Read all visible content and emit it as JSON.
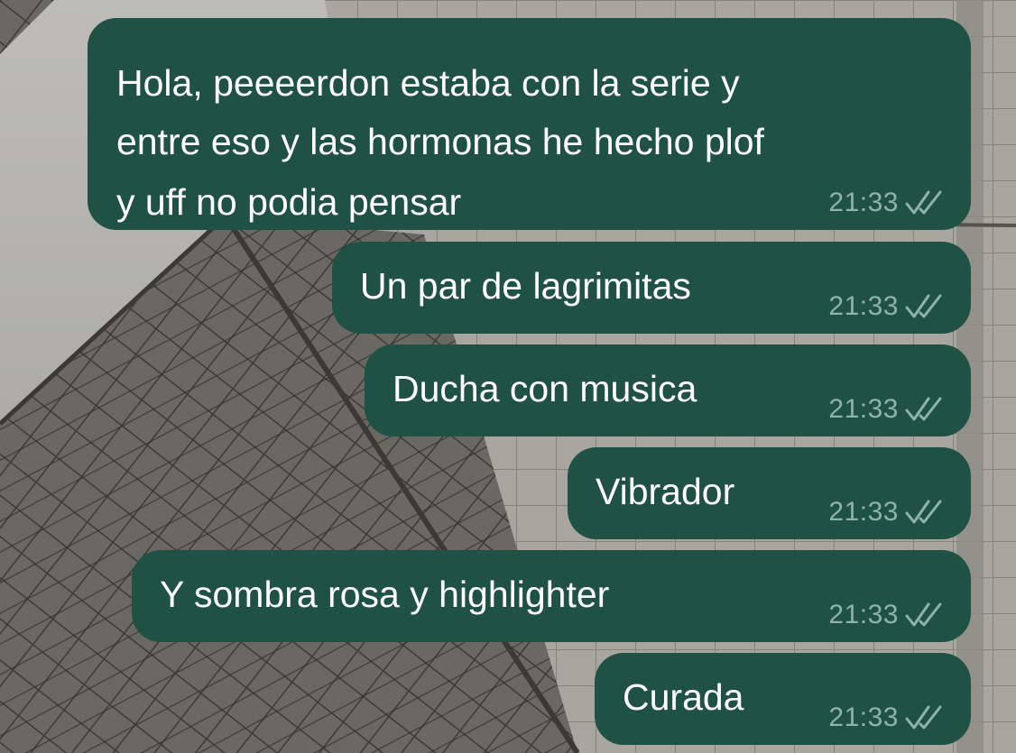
{
  "chat": {
    "messages": [
      {
        "lines": [
          "Hola, peeeerdon estaba con la serie y",
          "entre eso y las hormonas he hecho plof",
          "y uff no podia pensar"
        ],
        "time": "21:33",
        "status_icon": "double-check-icon"
      },
      {
        "lines": [
          "Un par de lagrimitas"
        ],
        "time": "21:33",
        "status_icon": "double-check-icon"
      },
      {
        "lines": [
          "Ducha con musica"
        ],
        "time": "21:33",
        "status_icon": "double-check-icon"
      },
      {
        "lines": [
          "Vibrador"
        ],
        "time": "21:33",
        "status_icon": "double-check-icon"
      },
      {
        "lines": [
          "Y sombra rosa y highlighter"
        ],
        "time": "21:33",
        "status_icon": "double-check-icon"
      },
      {
        "lines": [
          "Curada"
        ],
        "time": "21:33",
        "status_icon": "double-check-icon"
      }
    ]
  },
  "colors": {
    "bubble_outgoing": "#1f5244",
    "message_text": "#ffffff",
    "meta_text": "#8fb3a7",
    "wallpaper": "#b0afa9"
  }
}
